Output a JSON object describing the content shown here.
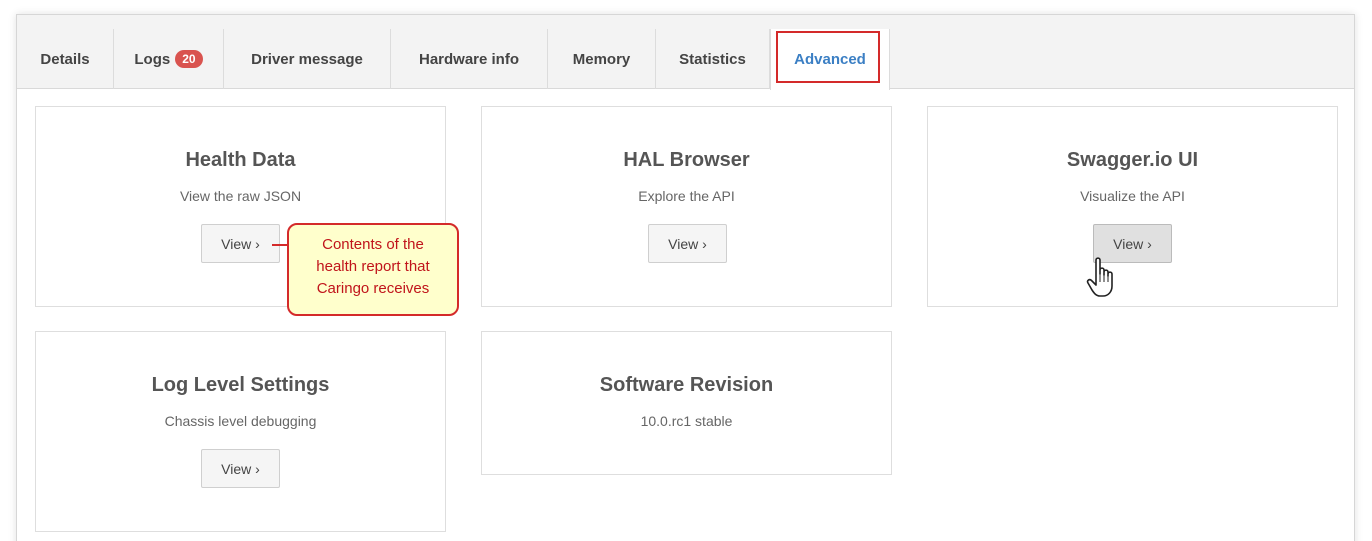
{
  "tabs": [
    {
      "label": "Details"
    },
    {
      "label": "Logs",
      "badge": "20"
    },
    {
      "label": "Driver message"
    },
    {
      "label": "Hardware info"
    },
    {
      "label": "Memory"
    },
    {
      "label": "Statistics"
    },
    {
      "label": "Advanced",
      "active": true
    }
  ],
  "cards": {
    "health": {
      "title": "Health Data",
      "subtitle": "View the raw JSON",
      "button": "View ›"
    },
    "hal": {
      "title": "HAL Browser",
      "subtitle": "Explore the API",
      "button": "View ›"
    },
    "swagger": {
      "title": "Swagger.io UI",
      "subtitle": "Visualize the API",
      "button": "View ›"
    },
    "loglevel": {
      "title": "Log Level Settings",
      "subtitle": "Chassis level debugging",
      "button": "View ›"
    },
    "software": {
      "title": "Software Revision",
      "subtitle": "10.0.rc1 stable"
    }
  },
  "callout": {
    "line1": "Contents of the",
    "line2": "health report that",
    "line3": "Caringo receives"
  },
  "colors": {
    "active_tab_text": "#3b7fc4",
    "badge_bg": "#d9534f",
    "annotation_red": "#d42a2a",
    "callout_bg": "#ffffcc"
  },
  "icons": {
    "cursor": "hand-pointer-icon"
  }
}
